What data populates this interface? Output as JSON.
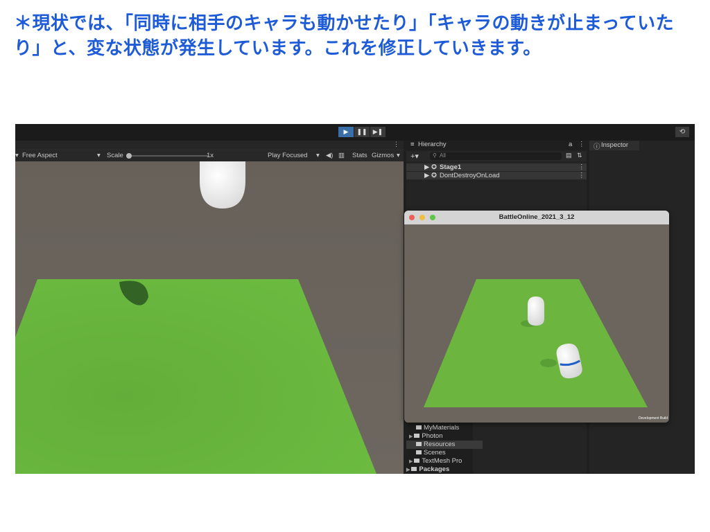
{
  "caption": "＊現状では、「同時に相手のキャラも動かせたり」「キャラの動きが止まっていたり」と、変な状態が発生しています。これを修正していきます。",
  "toolbar": {
    "play": "▶",
    "pause": "❚❚",
    "step": "▶❚",
    "history": "⟲"
  },
  "game": {
    "aspect": "Free Aspect",
    "scale_label": "Scale",
    "scale_value": "1x",
    "play_mode": "Play Focused",
    "stats": "Stats",
    "gizmos": "Gizmos"
  },
  "hierarchy": {
    "tab_label": "Hierarchy",
    "search_placeholder": "All",
    "items": [
      {
        "label": "Stage1"
      },
      {
        "label": "DontDestroyOnLoad"
      }
    ]
  },
  "inspector": {
    "tab_label": "Inspector"
  },
  "project": {
    "items": [
      {
        "label": "MyMaterials"
      },
      {
        "label": "Photon"
      },
      {
        "label": "Resources"
      },
      {
        "label": "Scenes"
      },
      {
        "label": "TextMesh Pro"
      },
      {
        "label": "Packages"
      }
    ]
  },
  "build_window": {
    "title": "BattleOnline_2021_3_12",
    "watermark": "Development Build"
  },
  "colors": {
    "caption": "#1e5bd7",
    "ground": "#6cb63f",
    "background": "#6b655d",
    "accent": "#3a6fa8"
  }
}
